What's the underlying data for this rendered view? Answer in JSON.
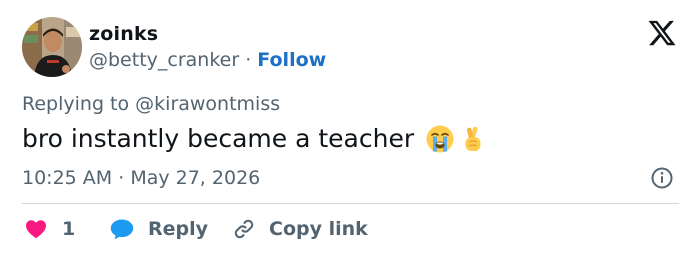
{
  "tweet": {
    "author": {
      "display_name": "zoinks",
      "handle": "@betty_cranker",
      "separator": " · ",
      "follow_label": "Follow"
    },
    "replying_prefix": "Replying to ",
    "replying_handle": "@kirawontmiss",
    "text": "bro instantly became a teacher",
    "emojis": [
      "loudly-crying-face-emoji",
      "crossed-fingers-emoji"
    ],
    "time": "10:25 AM",
    "date_separator": " · ",
    "date": "May 27, 2026"
  },
  "actions": {
    "like_count": "1",
    "reply_label": "Reply",
    "copy_label": "Copy link"
  },
  "colors": {
    "text": "#0f1419",
    "secondary": "#536471",
    "link": "#1d70c6",
    "like": "#f91880",
    "reply_icon": "#1d9bf0",
    "divider": "#cfd9de"
  },
  "icons": {
    "brand": "x-logo-icon",
    "info": "info-icon",
    "like": "heart-icon",
    "reply": "speech-bubble-icon",
    "copy": "link-icon"
  }
}
